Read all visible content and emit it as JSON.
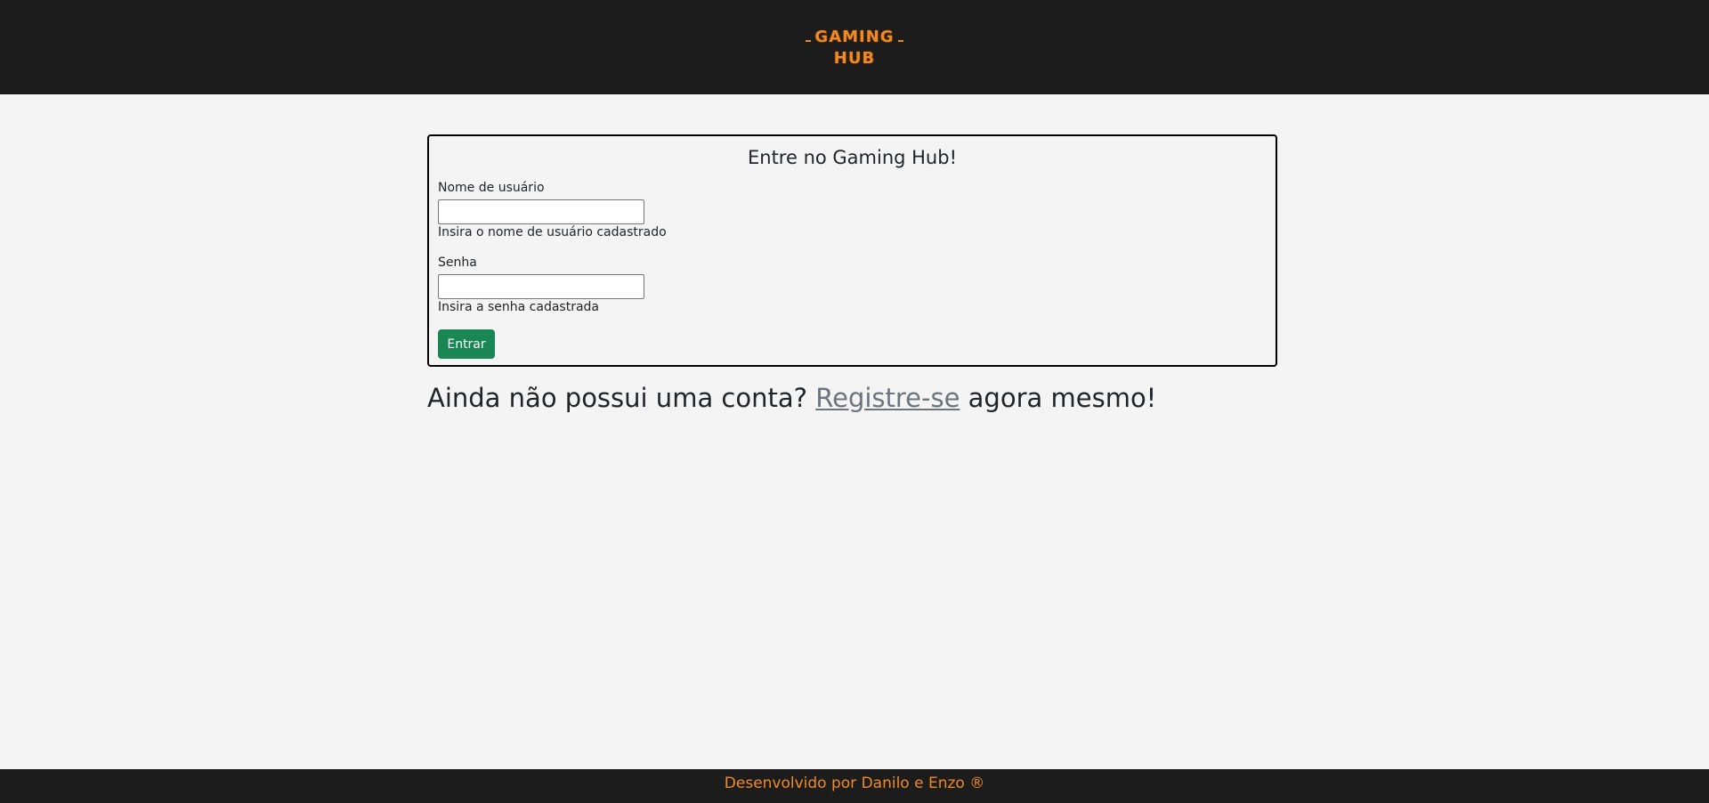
{
  "header": {
    "logo_line1": "GAMING",
    "logo_line2": "HUB"
  },
  "login": {
    "title": "Entre no Gaming Hub!",
    "username_label": "Nome de usuário",
    "username_value": "",
    "username_help": "Insira o nome de usuário cadastrado",
    "password_label": "Senha",
    "password_value": "",
    "password_help": "Insira a senha cadastrada",
    "submit_label": "Entrar"
  },
  "register": {
    "prefix": "Ainda não possui uma conta? ",
    "link_text": "Registre-se",
    "suffix": " agora mesmo!"
  },
  "footer": {
    "text": "Desenvolvido por Danilo e Enzo ®"
  },
  "colors": {
    "header_bg": "#1c1c1c",
    "accent_orange": "#f08a24",
    "button_green": "#198754",
    "page_bg": "#f4f4f4",
    "link_gray": "#6c757d"
  }
}
